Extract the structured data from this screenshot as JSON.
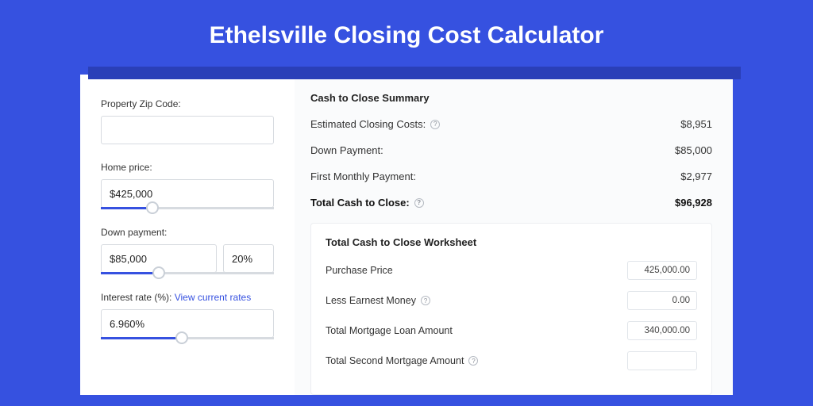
{
  "title": "Ethelsville Closing Cost Calculator",
  "inputs": {
    "zip_label": "Property Zip Code:",
    "zip_value": "",
    "home_price_label": "Home price:",
    "home_price_value": "$425,000",
    "down_payment_label": "Down payment:",
    "down_payment_value": "$85,000",
    "down_payment_pct": "20%",
    "interest_label": "Interest rate (%):",
    "interest_link": "View current rates",
    "interest_value": "6.960%"
  },
  "summary": {
    "heading": "Cash to Close Summary",
    "rows": [
      {
        "label": "Estimated Closing Costs:",
        "value": "$8,951",
        "help": true
      },
      {
        "label": "Down Payment:",
        "value": "$85,000",
        "help": false
      },
      {
        "label": "First Monthly Payment:",
        "value": "$2,977",
        "help": false
      }
    ],
    "total_label": "Total Cash to Close:",
    "total_value": "$96,928"
  },
  "worksheet": {
    "heading": "Total Cash to Close Worksheet",
    "rows": [
      {
        "label": "Purchase Price",
        "value": "425,000.00",
        "help": false
      },
      {
        "label": "Less Earnest Money",
        "value": "0.00",
        "help": true
      },
      {
        "label": "Total Mortgage Loan Amount",
        "value": "340,000.00",
        "help": false
      },
      {
        "label": "Total Second Mortgage Amount",
        "value": "",
        "help": true
      }
    ]
  }
}
